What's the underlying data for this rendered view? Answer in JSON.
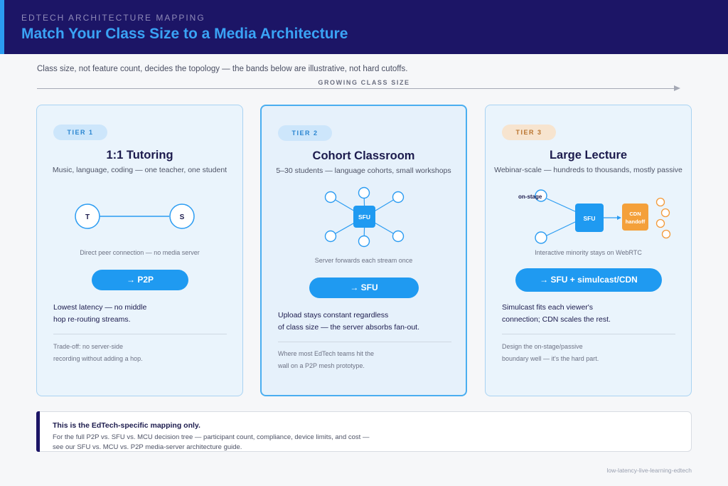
{
  "header": {
    "eyebrow": "EDTECH ARCHITECTURE MAPPING",
    "title": "Match Your Class Size to a Media Architecture"
  },
  "intro": {
    "subtitle": "Class size, not feature count, decides the topology — the bands below are illustrative, not hard cutoffs.",
    "axis_label": "GROWING CLASS SIZE"
  },
  "tiers": [
    {
      "badge": "TIER 1",
      "title": "1:1 Tutoring",
      "subtitle": "Music, language, coding — one teacher, one student",
      "nodes": [
        "T",
        "S"
      ],
      "caption": "Direct peer connection — no media server",
      "button": "→ P2P",
      "description": [
        "Lowest latency — no middle",
        "hop re-routing streams."
      ],
      "note": [
        "Trade-off: no server-side",
        "recording without adding a hop."
      ]
    },
    {
      "badge": "TIER 2",
      "title": "Cohort Classroom",
      "subtitle": "5–30 students — language cohorts, small workshops",
      "hub": "SFU",
      "caption": "Server forwards each stream once",
      "button": "→ SFU",
      "description": [
        "Upload stays constant regardless",
        "of class size — the server absorbs fan-out."
      ],
      "note": [
        "Where most EdTech teams hit the",
        "wall on a P2P mesh prototype."
      ]
    },
    {
      "badge": "TIER 3",
      "title": "Large Lecture",
      "subtitle": "Webinar-scale — hundreds to thousands, mostly passive",
      "onstage_label": "on-stage",
      "hub": "SFU",
      "cdn_line1": "CDN",
      "cdn_line2": "handoff",
      "caption": "Interactive minority stays on WebRTC",
      "button": "→ SFU + simulcast/CDN",
      "description": [
        "Simulcast fits each viewer's",
        "connection; CDN scales the rest."
      ],
      "note": [
        "Design the on-stage/passive",
        "boundary well — it's the hard part."
      ]
    }
  ],
  "callout": {
    "title": "This is the EdTech-specific mapping only.",
    "line1": "For the full P2P vs. SFU vs. MCU decision tree — participant count, compliance, device limits, and cost —",
    "line2": "see our SFU vs. MCU vs. P2P media-server architecture guide."
  },
  "footer": {
    "slug": "low-latency-live-learning-edtech"
  },
  "colors": {
    "header_bg": "#1c1566",
    "accent_blue": "#1f9af1",
    "title_blue": "#3aa3f5",
    "cdn_orange": "#f4a03a",
    "passive_orange": "#f29a3a"
  }
}
